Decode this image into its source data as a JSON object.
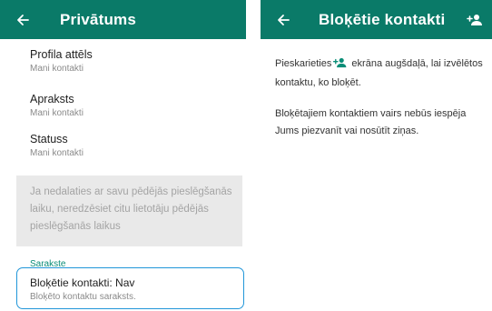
{
  "privacy_screen": {
    "title": "Privātums",
    "rows": [
      {
        "title": "Profila attēls",
        "subtitle": "Mani kontakti"
      },
      {
        "title": "Apraksts",
        "subtitle": "Mani kontakti"
      },
      {
        "title": "Statuss",
        "subtitle": "Mani kontakti"
      }
    ],
    "info_text": "Ja nedalaties ar savu pēdējās pieslēgšanās laiku, neredzēsiet citu lietotāju pēdējās pieslēgšanās laikus",
    "section_label": "Sarakste",
    "blocked_row": {
      "title": "Bloķētie kontakti: Nav",
      "subtitle": "Bloķēto kontaktu saraksts."
    }
  },
  "blocked_screen": {
    "title": "Bloķētie kontakti",
    "instruction_before_icon": "Pieskarieties",
    "instruction_after_icon": "ekrāna augšdaļā, lai izvēlētos kontaktu, ko bloķēt.",
    "note": "Bloķētajiem kontaktiem vairs nebūs iespēja Jums piezvanīt vai nosūtīt ziņas."
  },
  "colors": {
    "appbar": "#0a7a68",
    "accent_green": "#0a8d77",
    "highlight_border": "#2196d9",
    "info_box": "#e9e9e9"
  },
  "icons": {
    "back": "arrow-left-icon",
    "add_contact": "person-add-icon"
  }
}
